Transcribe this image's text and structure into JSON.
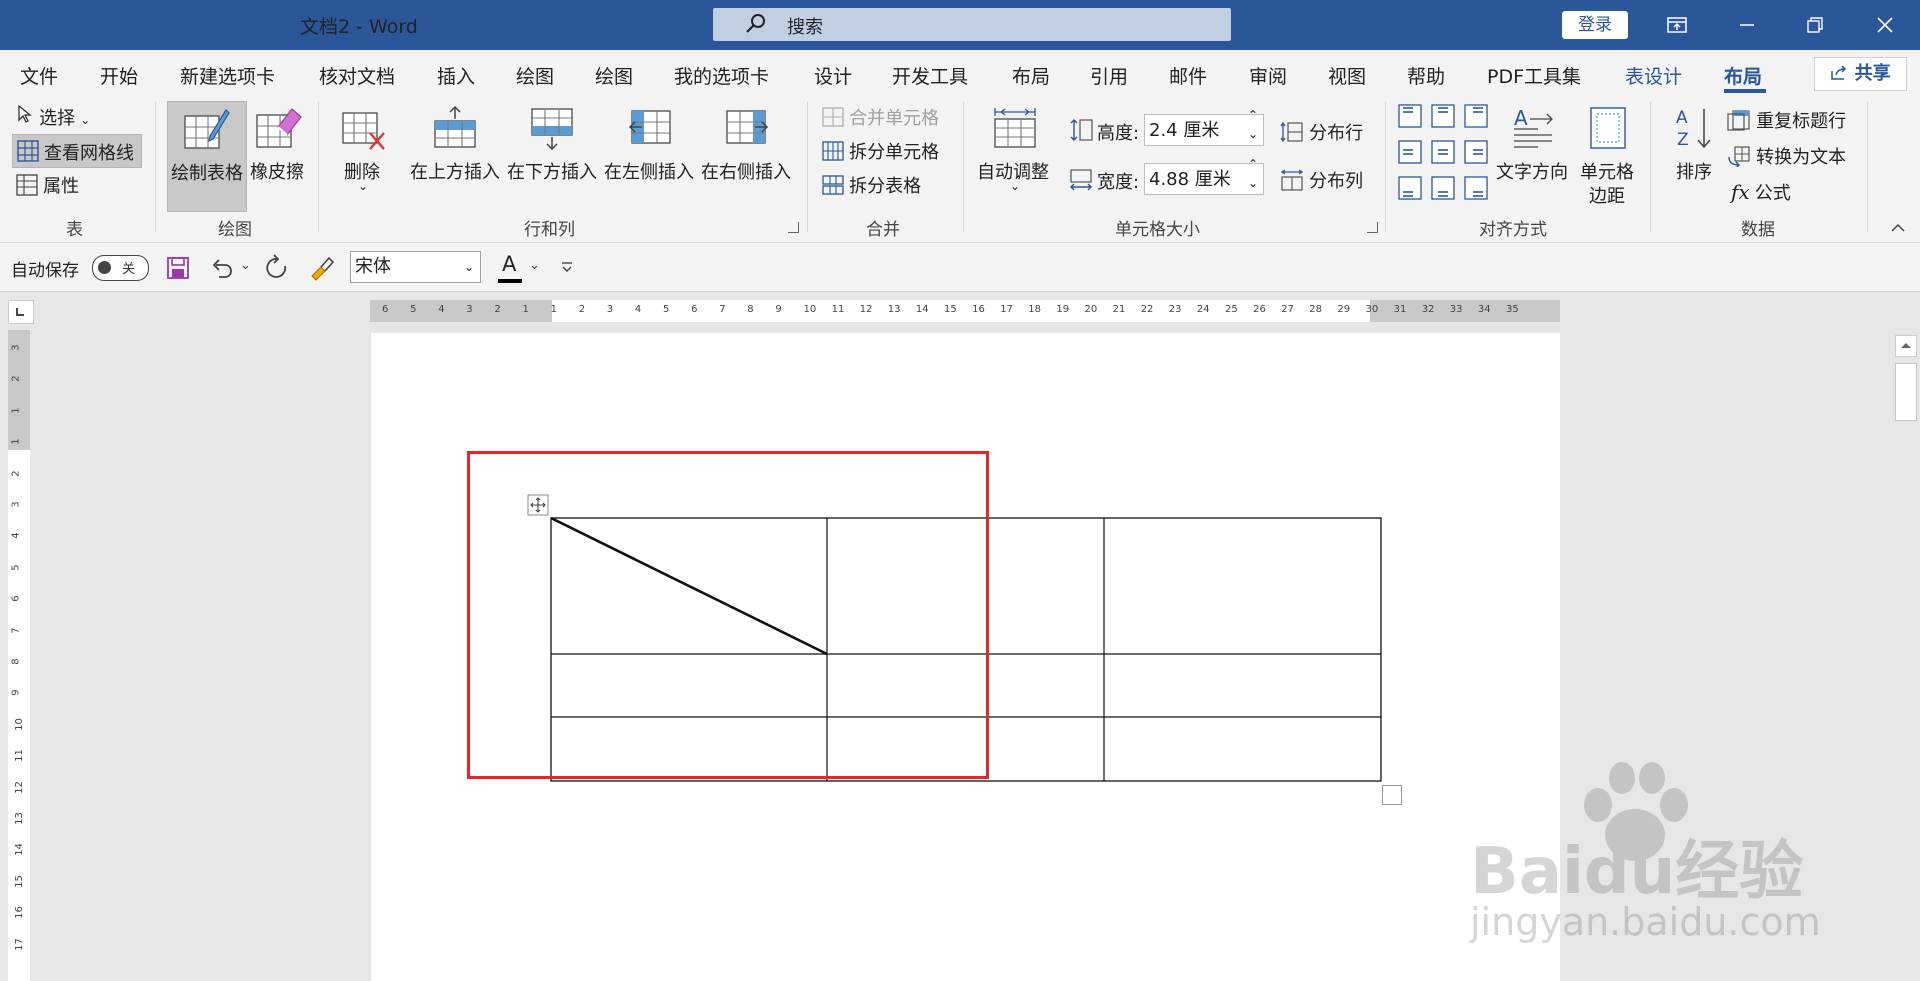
{
  "titlebar": {
    "doc_title": "文档2  -  Word",
    "search_placeholder": "搜索",
    "login": "登录",
    "controls": [
      "ribbon-display-options",
      "minimize",
      "restore",
      "close"
    ]
  },
  "tabs": [
    "文件",
    "开始",
    "新建选项卡",
    "核对文档",
    "插入",
    "绘图",
    "绘图",
    "我的选项卡",
    "设计",
    "开发工具",
    "布局",
    "引用",
    "邮件",
    "审阅",
    "视图",
    "帮助",
    "PDF工具集",
    "表设计",
    "布局"
  ],
  "active_tab_index": 18,
  "share_label": "共享",
  "ribbon": {
    "table_group": {
      "label": "表",
      "select": "选择",
      "view_gridlines": "查看网格线",
      "properties": "属性"
    },
    "draw_group": {
      "label": "绘图",
      "draw_table": "绘制表格",
      "eraser": "橡皮擦"
    },
    "rowcol_group": {
      "label": "行和列",
      "delete": "删除",
      "insert_above": "在上方插入",
      "insert_below": "在下方插入",
      "insert_left": "在左侧插入",
      "insert_right": "在右侧插入"
    },
    "merge_group": {
      "label": "合并",
      "merge_cells": "合并单元格",
      "split_cells": "拆分单元格",
      "split_table": "拆分表格"
    },
    "cellsize_group": {
      "label": "单元格大小",
      "autofit": "自动调整",
      "height_label": "高度:",
      "height_value": "2.4 厘米",
      "width_label": "宽度:",
      "width_value": "4.88 厘米",
      "distribute_rows": "分布行",
      "distribute_cols": "分布列"
    },
    "align_group": {
      "label": "对齐方式",
      "text_direction": "文字方向",
      "cell_margins_1": "单元格",
      "cell_margins_2": "边距"
    },
    "data_group": {
      "label": "数据",
      "sort": "排序",
      "repeat_header": "重复标题行",
      "convert_text": "转换为文本",
      "formula": "公式"
    }
  },
  "qat": {
    "autosave": "自动保存",
    "autosave_state": "关",
    "font": "宋体"
  },
  "ruler_h": [
    "6",
    "5",
    "4",
    "3",
    "2",
    "1",
    "1",
    "2",
    "3",
    "4",
    "5",
    "6",
    "7",
    "8",
    "9",
    "10",
    "11",
    "12",
    "13",
    "14",
    "15",
    "16",
    "17",
    "18",
    "19",
    "20",
    "21",
    "22",
    "23",
    "24",
    "25",
    "26",
    "27",
    "28",
    "29",
    "30",
    "31",
    "32",
    "33",
    "34",
    "35"
  ],
  "ruler_v": [
    "3",
    "2",
    "1",
    "1",
    "2",
    "3",
    "4",
    "5",
    "6",
    "7",
    "8",
    "9",
    "10",
    "11",
    "12",
    "13",
    "14",
    "15",
    "16",
    "17"
  ],
  "watermark": {
    "brand": "Baidu经验",
    "url": "jingyan.baidu.com"
  },
  "colors": {
    "title_bg": "#2b579a",
    "accent": "#2b579a",
    "highlight_box": "#e8262a"
  }
}
